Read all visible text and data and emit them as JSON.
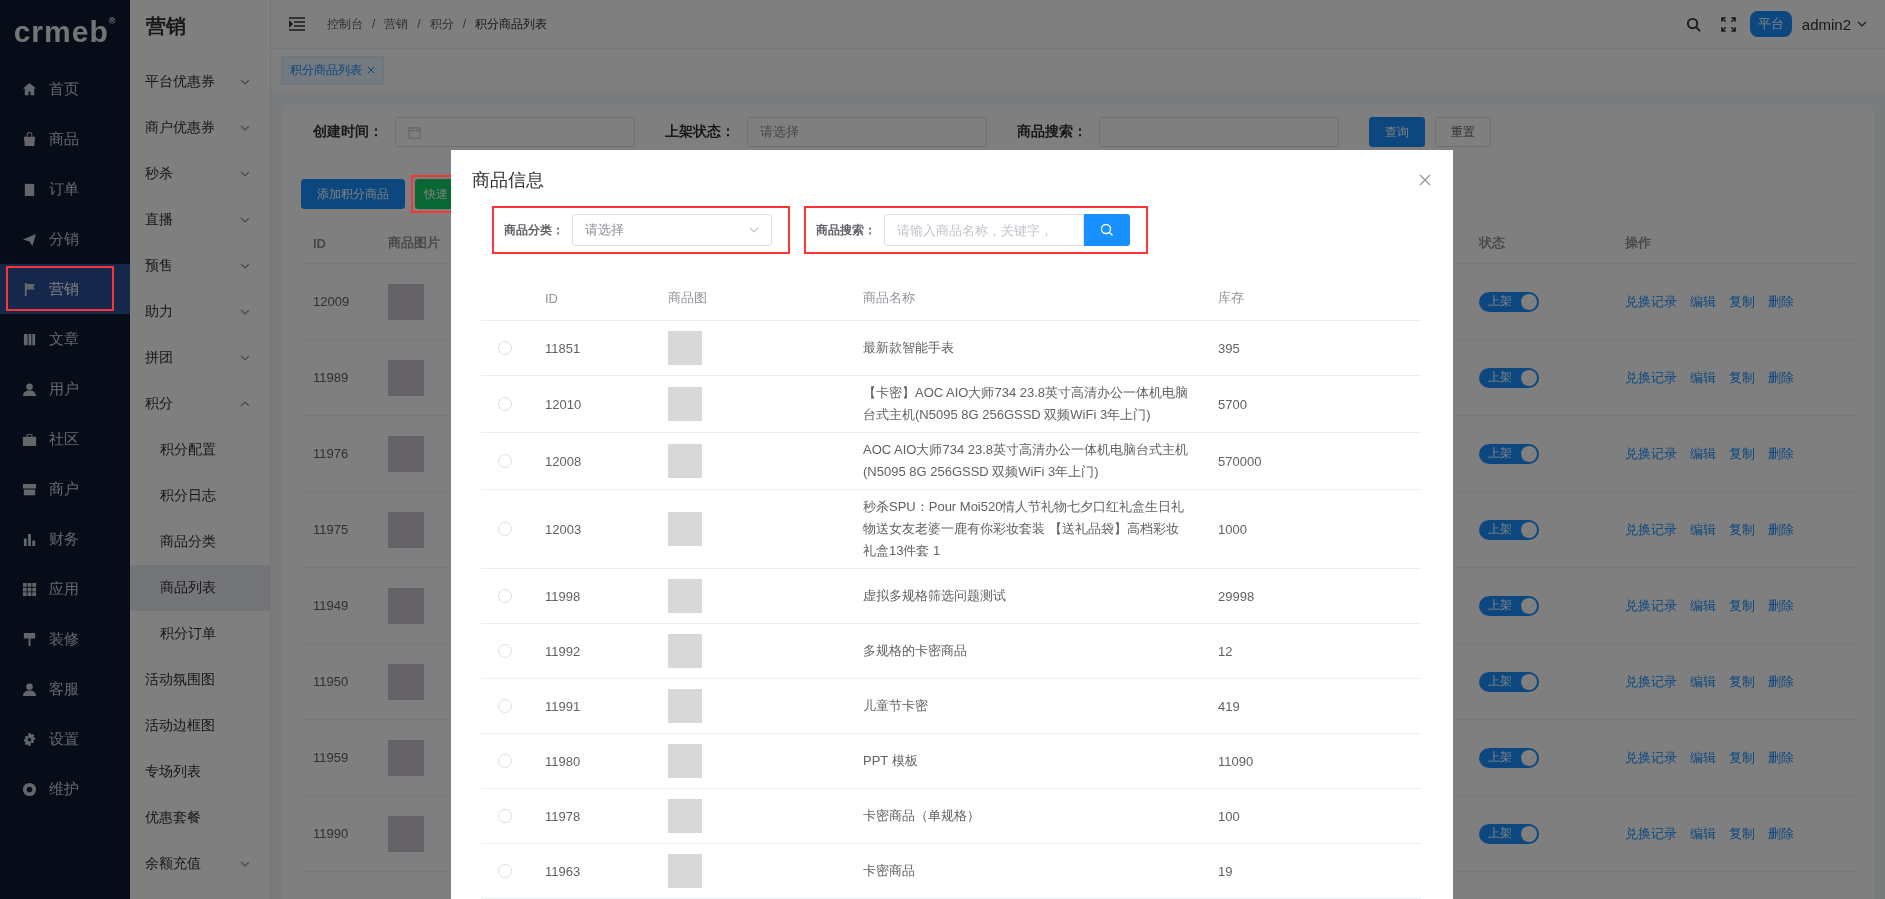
{
  "logo": {
    "text": "crmeb",
    "mark": "®"
  },
  "nav": [
    {
      "label": "首页",
      "selected": false
    },
    {
      "label": "商品",
      "selected": false
    },
    {
      "label": "订单",
      "selected": false
    },
    {
      "label": "分销",
      "selected": false
    },
    {
      "label": "营销",
      "selected": true
    },
    {
      "label": "文章",
      "selected": false
    },
    {
      "label": "用户",
      "selected": false
    },
    {
      "label": "社区",
      "selected": false
    },
    {
      "label": "商户",
      "selected": false
    },
    {
      "label": "财务",
      "selected": false
    },
    {
      "label": "应用",
      "selected": false
    },
    {
      "label": "装修",
      "selected": false
    },
    {
      "label": "客服",
      "selected": false
    },
    {
      "label": "设置",
      "selected": false
    },
    {
      "label": "维护",
      "selected": false
    }
  ],
  "submenu": {
    "title": "营销",
    "items": [
      {
        "kind": "group",
        "label": "平台优惠券",
        "expanded": false
      },
      {
        "kind": "group",
        "label": "商户优惠券",
        "expanded": false
      },
      {
        "kind": "group",
        "label": "秒杀",
        "expanded": false
      },
      {
        "kind": "group",
        "label": "直播",
        "expanded": false
      },
      {
        "kind": "group",
        "label": "预售",
        "expanded": false
      },
      {
        "kind": "group",
        "label": "助力",
        "expanded": false
      },
      {
        "kind": "group",
        "label": "拼团",
        "expanded": false
      },
      {
        "kind": "group",
        "label": "积分",
        "expanded": true,
        "children": [
          {
            "label": "积分配置",
            "selected": false
          },
          {
            "label": "积分日志",
            "selected": false
          },
          {
            "label": "商品分类",
            "selected": false
          },
          {
            "label": "商品列表",
            "selected": true
          },
          {
            "label": "积分订单",
            "selected": false
          }
        ]
      },
      {
        "kind": "link",
        "label": "活动氛围图",
        "selected": false
      },
      {
        "kind": "link",
        "label": "活动边框图",
        "selected": false
      },
      {
        "kind": "link",
        "label": "专场列表",
        "selected": false
      },
      {
        "kind": "link",
        "label": "优惠套餐",
        "selected": false
      },
      {
        "kind": "group",
        "label": "余额充值",
        "expanded": false
      }
    ]
  },
  "breadcrumb": [
    "控制台",
    "营销",
    "积分",
    "积分商品列表"
  ],
  "breadcrumb_separator": "/",
  "header": {
    "badge": "平台",
    "user": "admin2"
  },
  "tabs": [
    {
      "label": "积分商品列表",
      "selected": true
    }
  ],
  "filters": [
    {
      "kind": "date",
      "label": "创建时间："
    },
    {
      "kind": "select",
      "label": "上架状态：",
      "placeholder": "请选择"
    },
    {
      "kind": "input",
      "label": "商品搜索："
    }
  ],
  "filter_buttons": [
    {
      "kind": "primary",
      "label": "查询"
    },
    {
      "kind": "default",
      "label": "重置"
    }
  ],
  "actions": [
    {
      "kind": "primary",
      "label": "添加积分商品"
    },
    {
      "kind": "success",
      "label": "快速"
    }
  ],
  "table": {
    "columns": {
      "id": "ID",
      "image": "商品图片",
      "status": "状态",
      "actions": "操作"
    },
    "rows": [
      {
        "id": "12009",
        "status": {
          "on": true,
          "label": "上架"
        },
        "actions": [
          "兑换记录",
          "编辑",
          "复制",
          "删除"
        ]
      },
      {
        "id": "11989",
        "status": {
          "on": true,
          "label": "上架"
        },
        "actions": [
          "兑换记录",
          "编辑",
          "复制",
          "删除"
        ]
      },
      {
        "id": "11976",
        "status": {
          "on": true,
          "label": "上架"
        },
        "actions": [
          "兑换记录",
          "编辑",
          "复制",
          "删除"
        ]
      },
      {
        "id": "11975",
        "status": {
          "on": true,
          "label": "上架"
        },
        "actions": [
          "兑换记录",
          "编辑",
          "复制",
          "删除"
        ]
      },
      {
        "id": "11949",
        "status": {
          "on": true,
          "label": "上架"
        },
        "actions": [
          "兑换记录",
          "编辑",
          "复制",
          "删除"
        ]
      },
      {
        "id": "11950",
        "status": {
          "on": true,
          "label": "上架"
        },
        "actions": [
          "兑换记录",
          "编辑",
          "复制",
          "删除"
        ]
      },
      {
        "id": "11959",
        "status": {
          "on": true,
          "label": "上架"
        },
        "actions": [
          "兑换记录",
          "编辑",
          "复制",
          "删除"
        ]
      },
      {
        "id": "11990",
        "status": {
          "on": true,
          "label": "上架"
        },
        "actions": [
          "兑换记录",
          "编辑",
          "复制",
          "删除"
        ]
      }
    ]
  },
  "modal": {
    "title": "商品信息",
    "filters": [
      {
        "kind": "select",
        "label": "商品分类：",
        "placeholder": "请选择"
      },
      {
        "kind": "search",
        "label": "商品搜索：",
        "placeholder": "请输入商品名称，关键字，"
      }
    ],
    "columns": {
      "id": "ID",
      "image": "商品图",
      "name": "商品名称",
      "stock": "库存"
    },
    "rows": [
      {
        "selected": false,
        "id": "11851",
        "name": "最新款智能手表",
        "stock": "395"
      },
      {
        "selected": false,
        "id": "12010",
        "name": "【卡密】AOC AIO大师734 23.8英寸高清办公一体机电脑台式主机(N5095 8G 256GSSD 双频WiFi 3年上门)",
        "stock": "5700"
      },
      {
        "selected": false,
        "id": "12008",
        "name": "AOC AIO大师734 23.8英寸高清办公一体机电脑台式主机(N5095 8G 256GSSD 双频WiFi 3年上门)",
        "stock": "570000"
      },
      {
        "selected": false,
        "id": "12003",
        "name": "秒杀SPU：Pour Moi520情人节礼物七夕口红礼盒生日礼物送女友老婆一鹿有你彩妆套装 【送礼品袋】高档彩妆礼盒13件套 1",
        "stock": "1000"
      },
      {
        "selected": false,
        "id": "11998",
        "name": "虚拟多规格筛选问题测试",
        "stock": "29998"
      },
      {
        "selected": false,
        "id": "11992",
        "name": "多规格的卡密商品",
        "stock": "12"
      },
      {
        "selected": false,
        "id": "11991",
        "name": "儿童节卡密",
        "stock": "419"
      },
      {
        "selected": false,
        "id": "11980",
        "name": "PPT 模板",
        "stock": "11090"
      },
      {
        "selected": false,
        "id": "11978",
        "name": "卡密商品（单规格）",
        "stock": "100"
      },
      {
        "selected": false,
        "id": "11963",
        "name": "卡密商品",
        "stock": "19"
      }
    ]
  }
}
